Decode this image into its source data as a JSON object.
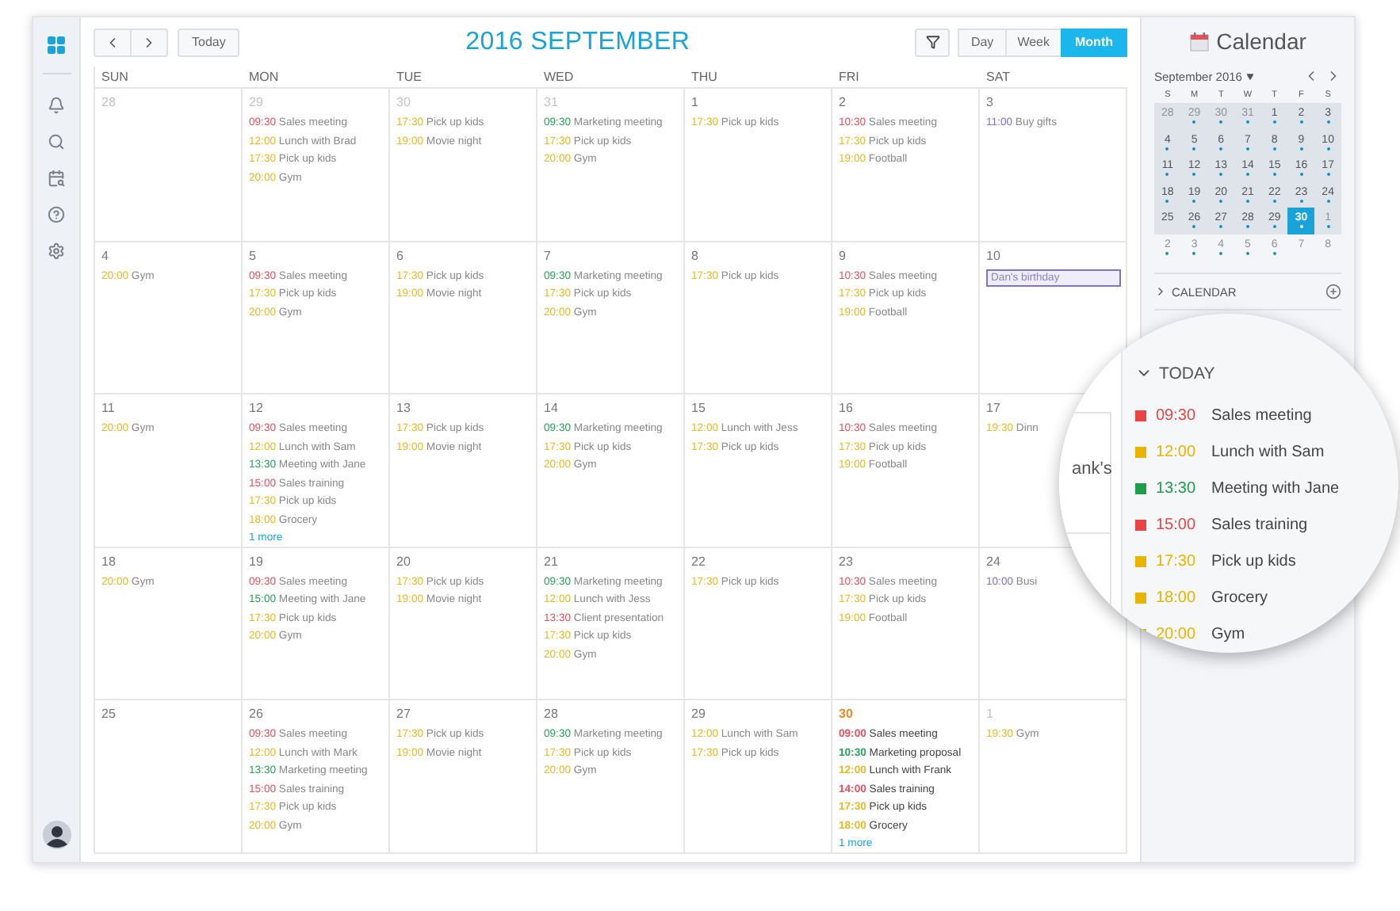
{
  "sidebar": {
    "items": [
      {
        "kind": "apps",
        "selected": true
      },
      {
        "kind": "notifications",
        "selected": false
      },
      {
        "kind": "search",
        "selected": false
      },
      {
        "kind": "find-date",
        "selected": false
      },
      {
        "kind": "help",
        "selected": false
      },
      {
        "kind": "settings",
        "selected": false
      }
    ],
    "avatar": {
      "kind": "user"
    }
  },
  "toolbar": {
    "today_button": "Today",
    "title": "2016 SEPTEMBER",
    "views": [
      {
        "label": "Day",
        "selected": false
      },
      {
        "label": "Week",
        "selected": false
      },
      {
        "label": "Month",
        "selected": true
      }
    ]
  },
  "weekdays": [
    "SUN",
    "MON",
    "TUE",
    "WED",
    "THU",
    "FRI",
    "SAT"
  ],
  "weeks": [
    [
      {
        "day": "28",
        "muted": true,
        "today": false
      },
      {
        "day": "29",
        "muted": true,
        "today": false,
        "events": [
          {
            "kind": "timed",
            "time": "09:30",
            "title": "Sales meeting",
            "color": "#e8505b"
          },
          {
            "kind": "timed",
            "time": "12:00",
            "title": "Lunch with Brad",
            "color": "#e8b923"
          },
          {
            "kind": "timed",
            "time": "17:30",
            "title": "Pick up kids",
            "color": "#e8b923"
          },
          {
            "kind": "timed",
            "time": "20:00",
            "title": "Gym",
            "color": "#e8b923"
          }
        ]
      },
      {
        "day": "30",
        "muted": true,
        "today": false,
        "events": [
          {
            "kind": "timed",
            "time": "17:30",
            "title": "Pick up kids",
            "color": "#e8b923"
          },
          {
            "kind": "timed",
            "time": "19:00",
            "title": "Movie night",
            "color": "#e8b923"
          }
        ]
      },
      {
        "day": "31",
        "muted": true,
        "today": false,
        "events": [
          {
            "kind": "timed",
            "time": "09:30",
            "title": "Marketing meeting",
            "color": "#27a35a"
          },
          {
            "kind": "timed",
            "time": "17:30",
            "title": "Pick up kids",
            "color": "#e8b923"
          },
          {
            "kind": "timed",
            "time": "20:00",
            "title": "Gym",
            "color": "#e8b923"
          }
        ]
      },
      {
        "day": "1",
        "muted": false,
        "today": false,
        "events": [
          {
            "kind": "timed",
            "time": "17:30",
            "title": "Pick up kids",
            "color": "#e8b923"
          }
        ]
      },
      {
        "day": "2",
        "muted": false,
        "today": false,
        "events": [
          {
            "kind": "timed",
            "time": "10:30",
            "title": "Sales meeting",
            "color": "#e8505b"
          },
          {
            "kind": "timed",
            "time": "17:30",
            "title": "Pick up kids",
            "color": "#e8b923"
          },
          {
            "kind": "timed",
            "time": "19:00",
            "title": "Football",
            "color": "#e8b923"
          }
        ]
      },
      {
        "day": "3",
        "muted": false,
        "today": false,
        "events": [
          {
            "kind": "timed",
            "time": "11:00",
            "title": "Buy gifts",
            "color": "#7e73c9"
          }
        ]
      }
    ],
    [
      {
        "day": "4",
        "muted": false,
        "today": false,
        "events": [
          {
            "kind": "timed",
            "time": "20:00",
            "title": "Gym",
            "color": "#e8b923"
          }
        ]
      },
      {
        "day": "5",
        "muted": false,
        "today": false,
        "events": [
          {
            "kind": "timed",
            "time": "09:30",
            "title": "Sales meeting",
            "color": "#e8505b"
          },
          {
            "kind": "timed",
            "time": "17:30",
            "title": "Pick up kids",
            "color": "#e8b923"
          },
          {
            "kind": "timed",
            "time": "20:00",
            "title": "Gym",
            "color": "#e8b923"
          }
        ]
      },
      {
        "day": "6",
        "muted": false,
        "today": false,
        "events": [
          {
            "kind": "timed",
            "time": "17:30",
            "title": "Pick up kids",
            "color": "#e8b923"
          },
          {
            "kind": "timed",
            "time": "19:00",
            "title": "Movie night",
            "color": "#e8b923"
          }
        ]
      },
      {
        "day": "7",
        "muted": false,
        "today": false,
        "events": [
          {
            "kind": "timed",
            "time": "09:30",
            "title": "Marketing meeting",
            "color": "#27a35a"
          },
          {
            "kind": "timed",
            "time": "17:30",
            "title": "Pick up kids",
            "color": "#e8b923"
          },
          {
            "kind": "timed",
            "time": "20:00",
            "title": "Gym",
            "color": "#e8b923"
          }
        ]
      },
      {
        "day": "8",
        "muted": false,
        "today": false,
        "events": [
          {
            "kind": "timed",
            "time": "17:30",
            "title": "Pick up kids",
            "color": "#e8b923"
          }
        ]
      },
      {
        "day": "9",
        "muted": false,
        "today": false,
        "events": [
          {
            "kind": "timed",
            "time": "10:30",
            "title": "Sales meeting",
            "color": "#e8505b"
          },
          {
            "kind": "timed",
            "time": "17:30",
            "title": "Pick up kids",
            "color": "#e8b923"
          },
          {
            "kind": "timed",
            "time": "19:00",
            "title": "Football",
            "color": "#e8b923"
          }
        ]
      },
      {
        "day": "10",
        "muted": false,
        "today": false,
        "events": [
          {
            "kind": "allday",
            "title": "Dan's birthday",
            "color": "#7e73c9"
          }
        ]
      }
    ],
    [
      {
        "day": "11",
        "muted": false,
        "today": false,
        "events": [
          {
            "kind": "timed",
            "time": "20:00",
            "title": "Gym",
            "color": "#e8b923"
          }
        ]
      },
      {
        "day": "12",
        "muted": false,
        "today": false,
        "more": "1 more",
        "events": [
          {
            "kind": "timed",
            "time": "09:30",
            "title": "Sales meeting",
            "color": "#e8505b"
          },
          {
            "kind": "timed",
            "time": "12:00",
            "title": "Lunch with Sam",
            "color": "#e8b923"
          },
          {
            "kind": "timed",
            "time": "13:30",
            "title": "Meeting with Jane",
            "color": "#27a35a"
          },
          {
            "kind": "timed",
            "time": "15:00",
            "title": "Sales training",
            "color": "#e8505b"
          },
          {
            "kind": "timed",
            "time": "17:30",
            "title": "Pick up kids",
            "color": "#e8b923"
          },
          {
            "kind": "timed",
            "time": "18:00",
            "title": "Grocery",
            "color": "#e8b923"
          }
        ]
      },
      {
        "day": "13",
        "muted": false,
        "today": false,
        "events": [
          {
            "kind": "timed",
            "time": "17:30",
            "title": "Pick up kids",
            "color": "#e8b923"
          },
          {
            "kind": "timed",
            "time": "19:00",
            "title": "Movie night",
            "color": "#e8b923"
          }
        ]
      },
      {
        "day": "14",
        "muted": false,
        "today": false,
        "events": [
          {
            "kind": "timed",
            "time": "09:30",
            "title": "Marketing meeting",
            "color": "#27a35a"
          },
          {
            "kind": "timed",
            "time": "17:30",
            "title": "Pick up kids",
            "color": "#e8b923"
          },
          {
            "kind": "timed",
            "time": "20:00",
            "title": "Gym",
            "color": "#e8b923"
          }
        ]
      },
      {
        "day": "15",
        "muted": false,
        "today": false,
        "events": [
          {
            "kind": "timed",
            "time": "12:00",
            "title": "Lunch with Jess",
            "color": "#e8b923"
          },
          {
            "kind": "timed",
            "time": "17:30",
            "title": "Pick up kids",
            "color": "#e8b923"
          }
        ]
      },
      {
        "day": "16",
        "muted": false,
        "today": false,
        "events": [
          {
            "kind": "timed",
            "time": "10:30",
            "title": "Sales meeting",
            "color": "#e8505b"
          },
          {
            "kind": "timed",
            "time": "17:30",
            "title": "Pick up kids",
            "color": "#e8b923"
          },
          {
            "kind": "timed",
            "time": "19:00",
            "title": "Football",
            "color": "#e8b923"
          }
        ]
      },
      {
        "day": "17",
        "muted": false,
        "today": false,
        "events": [
          {
            "kind": "timed",
            "time": "19:30",
            "title": "Dinn",
            "color": "#e8b923"
          }
        ]
      }
    ],
    [
      {
        "day": "18",
        "muted": false,
        "today": false,
        "events": [
          {
            "kind": "timed",
            "time": "20:00",
            "title": "Gym",
            "color": "#e8b923"
          }
        ]
      },
      {
        "day": "19",
        "muted": false,
        "today": false,
        "events": [
          {
            "kind": "timed",
            "time": "09:30",
            "title": "Sales meeting",
            "color": "#e8505b"
          },
          {
            "kind": "timed",
            "time": "15:00",
            "title": "Meeting with Jane",
            "color": "#27a35a"
          },
          {
            "kind": "timed",
            "time": "17:30",
            "title": "Pick up kids",
            "color": "#e8b923"
          },
          {
            "kind": "timed",
            "time": "20:00",
            "title": "Gym",
            "color": "#e8b923"
          }
        ]
      },
      {
        "day": "20",
        "muted": false,
        "today": false,
        "events": [
          {
            "kind": "timed",
            "time": "17:30",
            "title": "Pick up kids",
            "color": "#e8b923"
          },
          {
            "kind": "timed",
            "time": "19:00",
            "title": "Movie night",
            "color": "#e8b923"
          }
        ]
      },
      {
        "day": "21",
        "muted": false,
        "today": false,
        "events": [
          {
            "kind": "timed",
            "time": "09:30",
            "title": "Marketing meeting",
            "color": "#27a35a"
          },
          {
            "kind": "timed",
            "time": "12:00",
            "title": "Lunch with Jess",
            "color": "#e8b923"
          },
          {
            "kind": "timed",
            "time": "13:30",
            "title": "Client presentation",
            "color": "#e8505b"
          },
          {
            "kind": "timed",
            "time": "17:30",
            "title": "Pick up kids",
            "color": "#e8b923"
          },
          {
            "kind": "timed",
            "time": "20:00",
            "title": "Gym",
            "color": "#e8b923"
          }
        ]
      },
      {
        "day": "22",
        "muted": false,
        "today": false,
        "events": [
          {
            "kind": "timed",
            "time": "17:30",
            "title": "Pick up kids",
            "color": "#e8b923"
          }
        ]
      },
      {
        "day": "23",
        "muted": false,
        "today": false,
        "events": [
          {
            "kind": "timed",
            "time": "10:30",
            "title": "Sales meeting",
            "color": "#e8505b"
          },
          {
            "kind": "timed",
            "time": "17:30",
            "title": "Pick up kids",
            "color": "#e8b923"
          },
          {
            "kind": "timed",
            "time": "19:00",
            "title": "Football",
            "color": "#e8b923"
          }
        ]
      },
      {
        "day": "24",
        "muted": false,
        "today": false,
        "events": [
          {
            "kind": "timed",
            "time": "10:00",
            "title": "Busi",
            "color": "#7e73c9"
          }
        ]
      }
    ],
    [
      {
        "day": "25",
        "muted": false,
        "today": false
      },
      {
        "day": "26",
        "muted": false,
        "today": false,
        "events": [
          {
            "kind": "timed",
            "time": "09:30",
            "title": "Sales meeting",
            "color": "#e8505b"
          },
          {
            "kind": "timed",
            "time": "12:00",
            "title": "Lunch with Mark",
            "color": "#e8b923"
          },
          {
            "kind": "timed",
            "time": "13:30",
            "title": "Marketing meeting",
            "color": "#27a35a"
          },
          {
            "kind": "timed",
            "time": "15:00",
            "title": "Sales training",
            "color": "#e8505b"
          },
          {
            "kind": "timed",
            "time": "17:30",
            "title": "Pick up kids",
            "color": "#e8b923"
          },
          {
            "kind": "timed",
            "time": "20:00",
            "title": "Gym",
            "color": "#e8b923"
          }
        ]
      },
      {
        "day": "27",
        "muted": false,
        "today": false,
        "events": [
          {
            "kind": "timed",
            "time": "17:30",
            "title": "Pick up kids",
            "color": "#e8b923"
          },
          {
            "kind": "timed",
            "time": "19:00",
            "title": "Movie night",
            "color": "#e8b923"
          }
        ]
      },
      {
        "day": "28",
        "muted": false,
        "today": false,
        "events": [
          {
            "kind": "timed",
            "time": "09:30",
            "title": "Marketing meeting",
            "color": "#27a35a"
          },
          {
            "kind": "timed",
            "time": "17:30",
            "title": "Pick up kids",
            "color": "#e8b923"
          },
          {
            "kind": "timed",
            "time": "20:00",
            "title": "Gym",
            "color": "#e8b923"
          }
        ]
      },
      {
        "day": "29",
        "muted": false,
        "today": false,
        "events": [
          {
            "kind": "timed",
            "time": "12:00",
            "title": "Lunch with Sam",
            "color": "#e8b923"
          },
          {
            "kind": "timed",
            "time": "17:30",
            "title": "Pick up kids",
            "color": "#e8b923"
          }
        ]
      },
      {
        "day": "30",
        "muted": false,
        "today": true,
        "more": "1 more",
        "events": [
          {
            "kind": "timed",
            "time": "09:00",
            "title": "Sales meeting",
            "color": "#e8505b"
          },
          {
            "kind": "timed",
            "time": "10:30",
            "title": "Marketing proposal",
            "color": "#27a35a"
          },
          {
            "kind": "timed",
            "time": "12:00",
            "title": "Lunch with Frank",
            "color": "#e8b923"
          },
          {
            "kind": "timed",
            "time": "14:00",
            "title": "Sales training",
            "color": "#e8505b"
          },
          {
            "kind": "timed",
            "time": "17:30",
            "title": "Pick up kids",
            "color": "#e8b923"
          },
          {
            "kind": "timed",
            "time": "18:00",
            "title": "Grocery",
            "color": "#e8b923"
          }
        ]
      },
      {
        "day": "1",
        "muted": true,
        "today": false,
        "events": [
          {
            "kind": "timed",
            "time": "19:30",
            "title": "Gym",
            "color": "#e8b923"
          }
        ]
      }
    ]
  ],
  "panel": {
    "title": "Calendar",
    "mini_calendar": {
      "month": "September 2016",
      "weekdays": [
        "S",
        "M",
        "T",
        "W",
        "T",
        "F",
        "S"
      ],
      "weeks": [
        [
          {
            "label": "28",
            "muted": true,
            "selected": false,
            "dot": false
          },
          {
            "label": "29",
            "muted": true,
            "selected": false,
            "dot": true
          },
          {
            "label": "30",
            "muted": true,
            "selected": false,
            "dot": true
          },
          {
            "label": "31",
            "muted": true,
            "selected": false,
            "dot": true
          },
          {
            "label": "1",
            "muted": false,
            "selected": false,
            "dot": true
          },
          {
            "label": "2",
            "muted": false,
            "selected": false,
            "dot": true
          },
          {
            "label": "3",
            "muted": false,
            "selected": false,
            "dot": true
          }
        ],
        [
          {
            "label": "4",
            "muted": false,
            "selected": false,
            "dot": true
          },
          {
            "label": "5",
            "muted": false,
            "selected": false,
            "dot": true
          },
          {
            "label": "6",
            "muted": false,
            "selected": false,
            "dot": true
          },
          {
            "label": "7",
            "muted": false,
            "selected": false,
            "dot": true
          },
          {
            "label": "8",
            "muted": false,
            "selected": false,
            "dot": true
          },
          {
            "label": "9",
            "muted": false,
            "selected": false,
            "dot": true
          },
          {
            "label": "10",
            "muted": false,
            "selected": false,
            "dot": true
          }
        ],
        [
          {
            "label": "11",
            "muted": false,
            "selected": false,
            "dot": true
          },
          {
            "label": "12",
            "muted": false,
            "selected": false,
            "dot": true
          },
          {
            "label": "13",
            "muted": false,
            "selected": false,
            "dot": true
          },
          {
            "label": "14",
            "muted": false,
            "selected": false,
            "dot": true
          },
          {
            "label": "15",
            "muted": false,
            "selected": false,
            "dot": true
          },
          {
            "label": "16",
            "muted": false,
            "selected": false,
            "dot": true
          },
          {
            "label": "17",
            "muted": false,
            "selected": false,
            "dot": true
          }
        ],
        [
          {
            "label": "18",
            "muted": false,
            "selected": false,
            "dot": true
          },
          {
            "label": "19",
            "muted": false,
            "selected": false,
            "dot": true
          },
          {
            "label": "20",
            "muted": false,
            "selected": false,
            "dot": true
          },
          {
            "label": "21",
            "muted": false,
            "selected": false,
            "dot": true
          },
          {
            "label": "22",
            "muted": false,
            "selected": false,
            "dot": true
          },
          {
            "label": "23",
            "muted": false,
            "selected": false,
            "dot": true
          },
          {
            "label": "24",
            "muted": false,
            "selected": false,
            "dot": true
          }
        ],
        [
          {
            "label": "25",
            "muted": false,
            "selected": false,
            "dot": false
          },
          {
            "label": "26",
            "muted": false,
            "selected": false,
            "dot": true
          },
          {
            "label": "27",
            "muted": false,
            "selected": false,
            "dot": true
          },
          {
            "label": "28",
            "muted": false,
            "selected": false,
            "dot": true
          },
          {
            "label": "29",
            "muted": false,
            "selected": false,
            "dot": true
          },
          {
            "label": "30",
            "muted": false,
            "selected": true,
            "dot": true
          },
          {
            "label": "1",
            "muted": true,
            "selected": false,
            "dot": true
          }
        ],
        [
          {
            "label": "2",
            "muted": true,
            "selected": false,
            "dot": true
          },
          {
            "label": "3",
            "muted": true,
            "selected": false,
            "dot": true
          },
          {
            "label": "4",
            "muted": true,
            "selected": false,
            "dot": true
          },
          {
            "label": "5",
            "muted": true,
            "selected": false,
            "dot": true
          },
          {
            "label": "6",
            "muted": true,
            "selected": false,
            "dot": true
          },
          {
            "label": "7",
            "muted": true,
            "selected": false,
            "dot": false
          },
          {
            "label": "8",
            "muted": true,
            "selected": false,
            "dot": false
          }
        ]
      ]
    },
    "calendars_section": {
      "label": "CALENDAR",
      "expanded": false
    }
  },
  "magnifier": {
    "fragment": "ank's",
    "today_section": {
      "label": "TODAY",
      "expanded": true,
      "items": [
        {
          "time": "09:30",
          "title": "Sales meeting",
          "color": "#e84545"
        },
        {
          "time": "12:00",
          "title": "Lunch with Sam",
          "color": "#e8b400"
        },
        {
          "time": "13:30",
          "title": "Meeting with Jane",
          "color": "#1f9e4a"
        },
        {
          "time": "15:00",
          "title": "Sales training",
          "color": "#e84545"
        },
        {
          "time": "17:30",
          "title": "Pick up kids",
          "color": "#e8b400"
        },
        {
          "time": "18:00",
          "title": "Grocery",
          "color": "#e8b400"
        },
        {
          "time": "20:00",
          "title": "Gym",
          "color": "#e8b400"
        }
      ]
    }
  }
}
